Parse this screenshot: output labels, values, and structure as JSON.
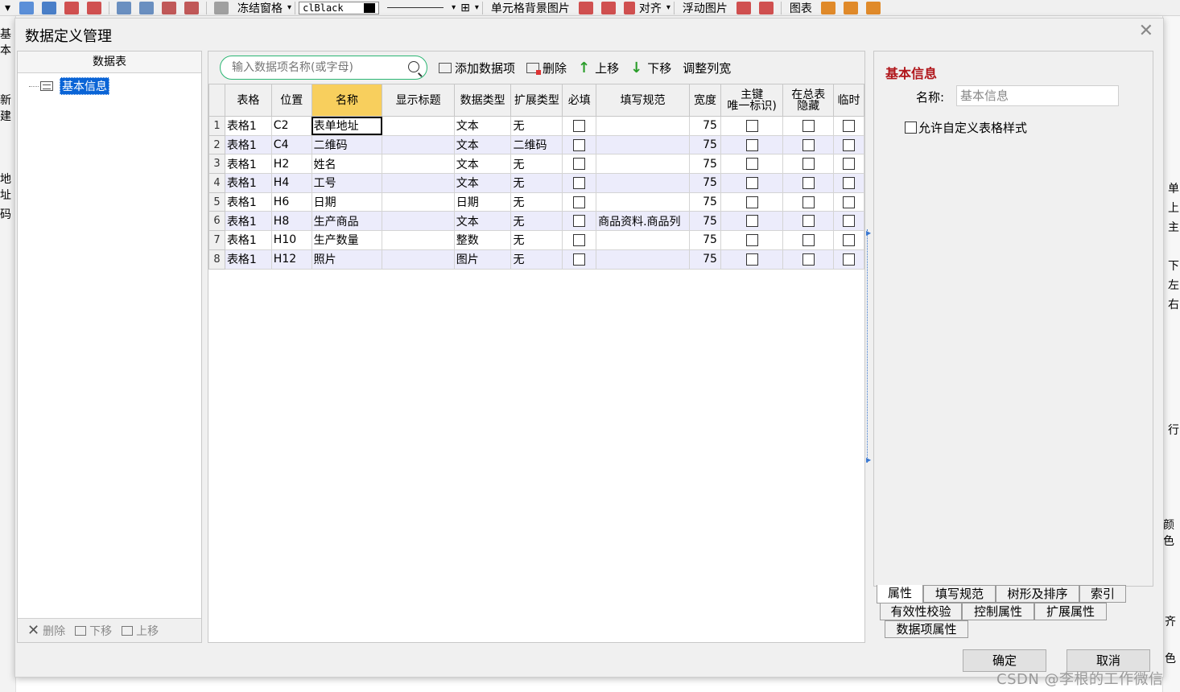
{
  "toolbar": {
    "freeze_label": "冻结窗格",
    "color_value": "clBlack",
    "cell_bg_label": "单元格背景图片",
    "align_label": "对齐",
    "float_img_label": "浮动图片",
    "chart_label": "图表"
  },
  "background": {
    "left_texts": [
      "基本",
      "新建",
      "地址",
      "码"
    ],
    "right_texts": [
      "单",
      "上",
      "主",
      "下",
      "左",
      "右",
      "行",
      "颜色",
      "齐",
      "色"
    ]
  },
  "dialog": {
    "title": "数据定义管理",
    "close_symbol": "✕"
  },
  "left_panel": {
    "header": "数据表",
    "tree_item": "基本信息",
    "footer": {
      "delete": "删除",
      "move_down": "下移",
      "move_up": "上移"
    }
  },
  "center_toolbar": {
    "search_placeholder": "输入数据项名称(或字母)",
    "add_item": "添加数据项",
    "delete": "删除",
    "move_up": "上移",
    "move_down": "下移",
    "adjust_width": "调整列宽"
  },
  "grid": {
    "headers": {
      "sheet": "表格",
      "position": "位置",
      "name": "名称",
      "display_title": "显示标题",
      "data_type": "数据类型",
      "ext_type": "扩展类型",
      "required": "必填",
      "fill_rule": "填写规范",
      "width": "宽度",
      "primary_key_1": "主键",
      "primary_key_2": "唯一标识)",
      "hidden_1": "在总表",
      "hidden_2": "隐藏",
      "temp": "临时"
    },
    "rows": [
      {
        "n": "1",
        "sheet": "表格1",
        "pos": "C2",
        "name": "表单地址",
        "title": "",
        "dtype": "文本",
        "etype": "无",
        "rule": "",
        "width": "75"
      },
      {
        "n": "2",
        "sheet": "表格1",
        "pos": "C4",
        "name": "二维码",
        "title": "",
        "dtype": "文本",
        "etype": "二维码",
        "rule": "",
        "width": "75"
      },
      {
        "n": "3",
        "sheet": "表格1",
        "pos": "H2",
        "name": "姓名",
        "title": "",
        "dtype": "文本",
        "etype": "无",
        "rule": "",
        "width": "75"
      },
      {
        "n": "4",
        "sheet": "表格1",
        "pos": "H4",
        "name": "工号",
        "title": "",
        "dtype": "文本",
        "etype": "无",
        "rule": "",
        "width": "75"
      },
      {
        "n": "5",
        "sheet": "表格1",
        "pos": "H6",
        "name": "日期",
        "title": "",
        "dtype": "日期",
        "etype": "无",
        "rule": "",
        "width": "75"
      },
      {
        "n": "6",
        "sheet": "表格1",
        "pos": "H8",
        "name": "生产商品",
        "title": "",
        "dtype": "文本",
        "etype": "无",
        "rule": "商品资料.商品列",
        "width": "75"
      },
      {
        "n": "7",
        "sheet": "表格1",
        "pos": "H10",
        "name": "生产数量",
        "title": "",
        "dtype": "整数",
        "etype": "无",
        "rule": "",
        "width": "75"
      },
      {
        "n": "8",
        "sheet": "表格1",
        "pos": "H12",
        "name": "照片",
        "title": "",
        "dtype": "图片",
        "etype": "无",
        "rule": "",
        "width": "75"
      }
    ]
  },
  "right_panel": {
    "title": "基本信息",
    "name_label": "名称:",
    "name_value": "基本信息",
    "custom_style_label": "允许自定义表格样式"
  },
  "tabs": {
    "row1": [
      "属性",
      "填写规范",
      "树形及排序",
      "索引"
    ],
    "row2": [
      "有效性校验",
      "控制属性",
      "扩展属性"
    ],
    "row3": [
      "数据项属性"
    ]
  },
  "buttons": {
    "ok": "确定",
    "cancel": "取消"
  },
  "watermark": "CSDN @李根的工作微信",
  "colors": {
    "accent_green": "#2bb673",
    "title_red": "#b0151a",
    "selected_header": "#f8cf5d",
    "row_alt": "#ececfb",
    "tree_selection": "#0a64d6"
  }
}
